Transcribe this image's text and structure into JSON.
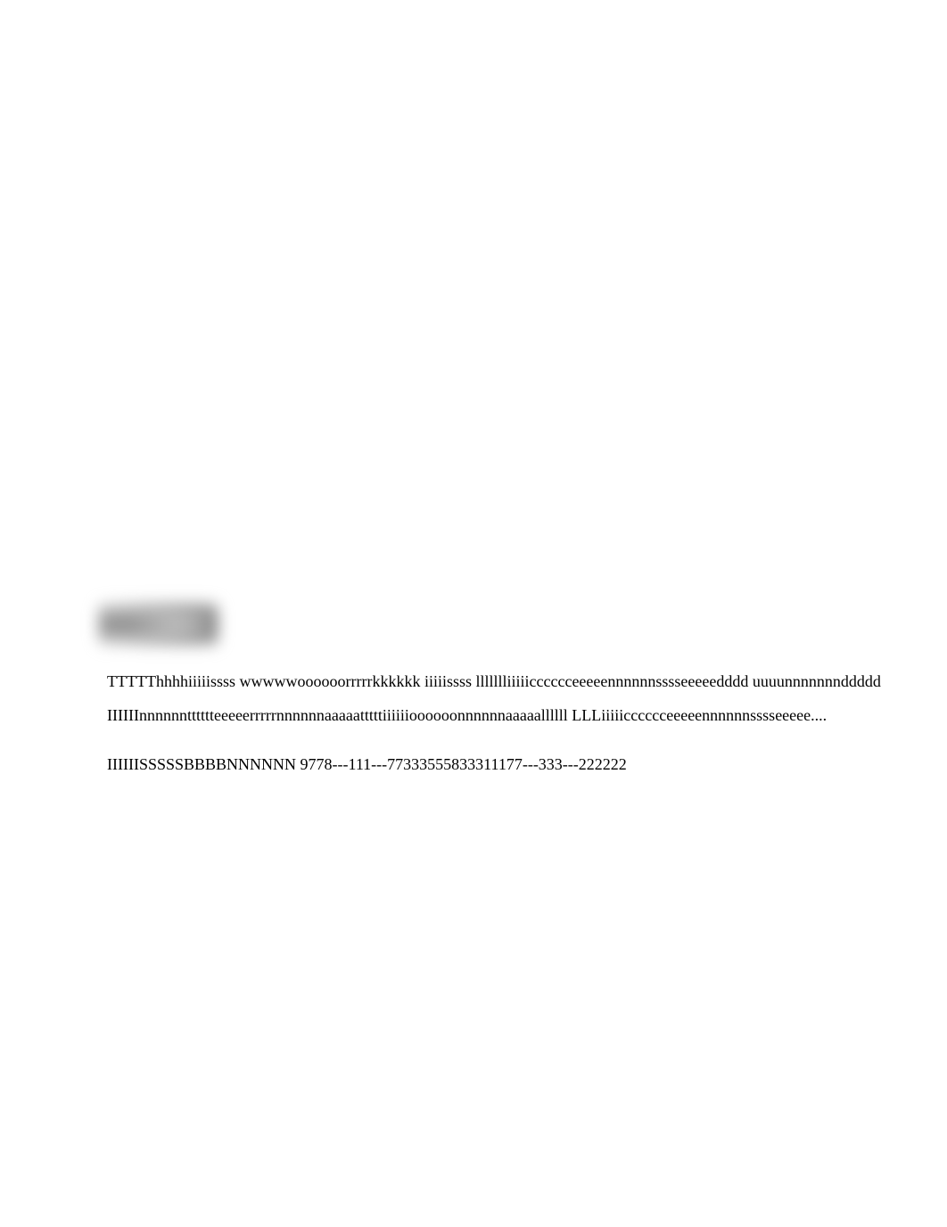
{
  "body": {
    "line1": "TTTTThhhhiiiiissss wwwwwoooooorrrrrkkkkkk iiiiissss llllllliiiiicccccceeeeennnnnnsssseeeeedddd uuuunnnnnnnddddd",
    "line2": "IIIIIInnnnnntttttteeeeerrrrrnnnnnnaaaaatttttiiiiiioooooonnnnnnaaaaallllll LLLiiiiicccccceeeeennnnnnsssseeeee....",
    "line3": "IIIIIISSSSSBBBBNNNNNN 9778---111---77333555833311177---333---222222"
  }
}
